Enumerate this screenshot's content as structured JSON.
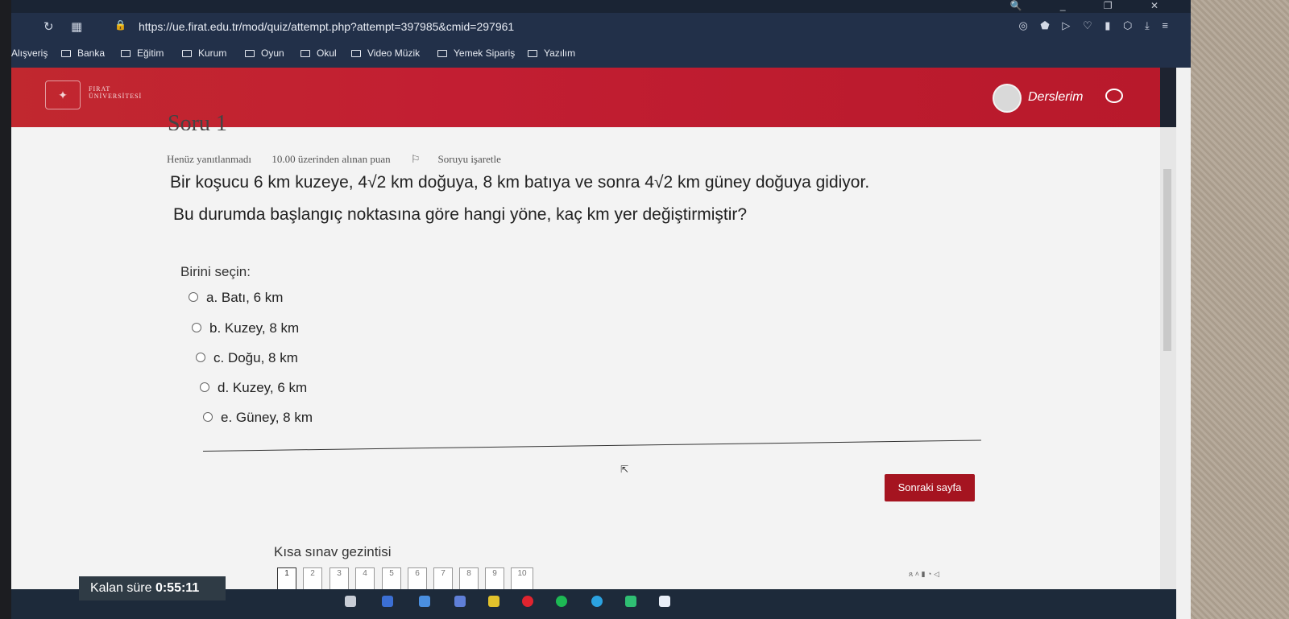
{
  "browser": {
    "url": "https://ue.firat.edu.tr/mod/quiz/attempt.php?attempt=397985&cmid=297961",
    "bookmarks": [
      "Alışveriş",
      "Banka",
      "Eğitim",
      "Kurum",
      "Oyun",
      "Okul",
      "Video Müzik",
      "Yemek Sipariş",
      "Yazılım"
    ]
  },
  "header": {
    "logo_line1": "FIRAT",
    "logo_line2": "ÜNİVERSİTESİ",
    "user_menu_label": "Derslerim",
    "color": "#c21e32"
  },
  "question": {
    "title": "Soru 1",
    "status": "Henüz yanıtlanmadı",
    "points": "10.00 üzerinden alınan puan",
    "flag_label": "Soruyu işaretle",
    "text_line1": "Bir koşucu 6 km kuzeye, 4√2 km doğuya, 8 km batıya ve sonra 4√2 km güney doğuya gidiyor.",
    "text_line2": "Bu durumda başlangıç noktasına göre hangi yöne, kaç km yer değiştirmiştir?",
    "prompt": "Birini seçin:",
    "options": [
      "a. Batı, 6 km",
      "b. Kuzey, 8 km",
      "c. Doğu, 8 km",
      "d. Kuzey, 6 km",
      "e. Güney, 8 km"
    ]
  },
  "next_button": "Sonraki sayfa",
  "quiz_nav": {
    "heading": "Kısa sınav gezintisi",
    "pages": [
      "1",
      "2",
      "3",
      "4",
      "5",
      "6",
      "7",
      "8",
      "9",
      "10"
    ]
  },
  "timer": {
    "label": "Kalan süre",
    "value": "0:55:11"
  }
}
